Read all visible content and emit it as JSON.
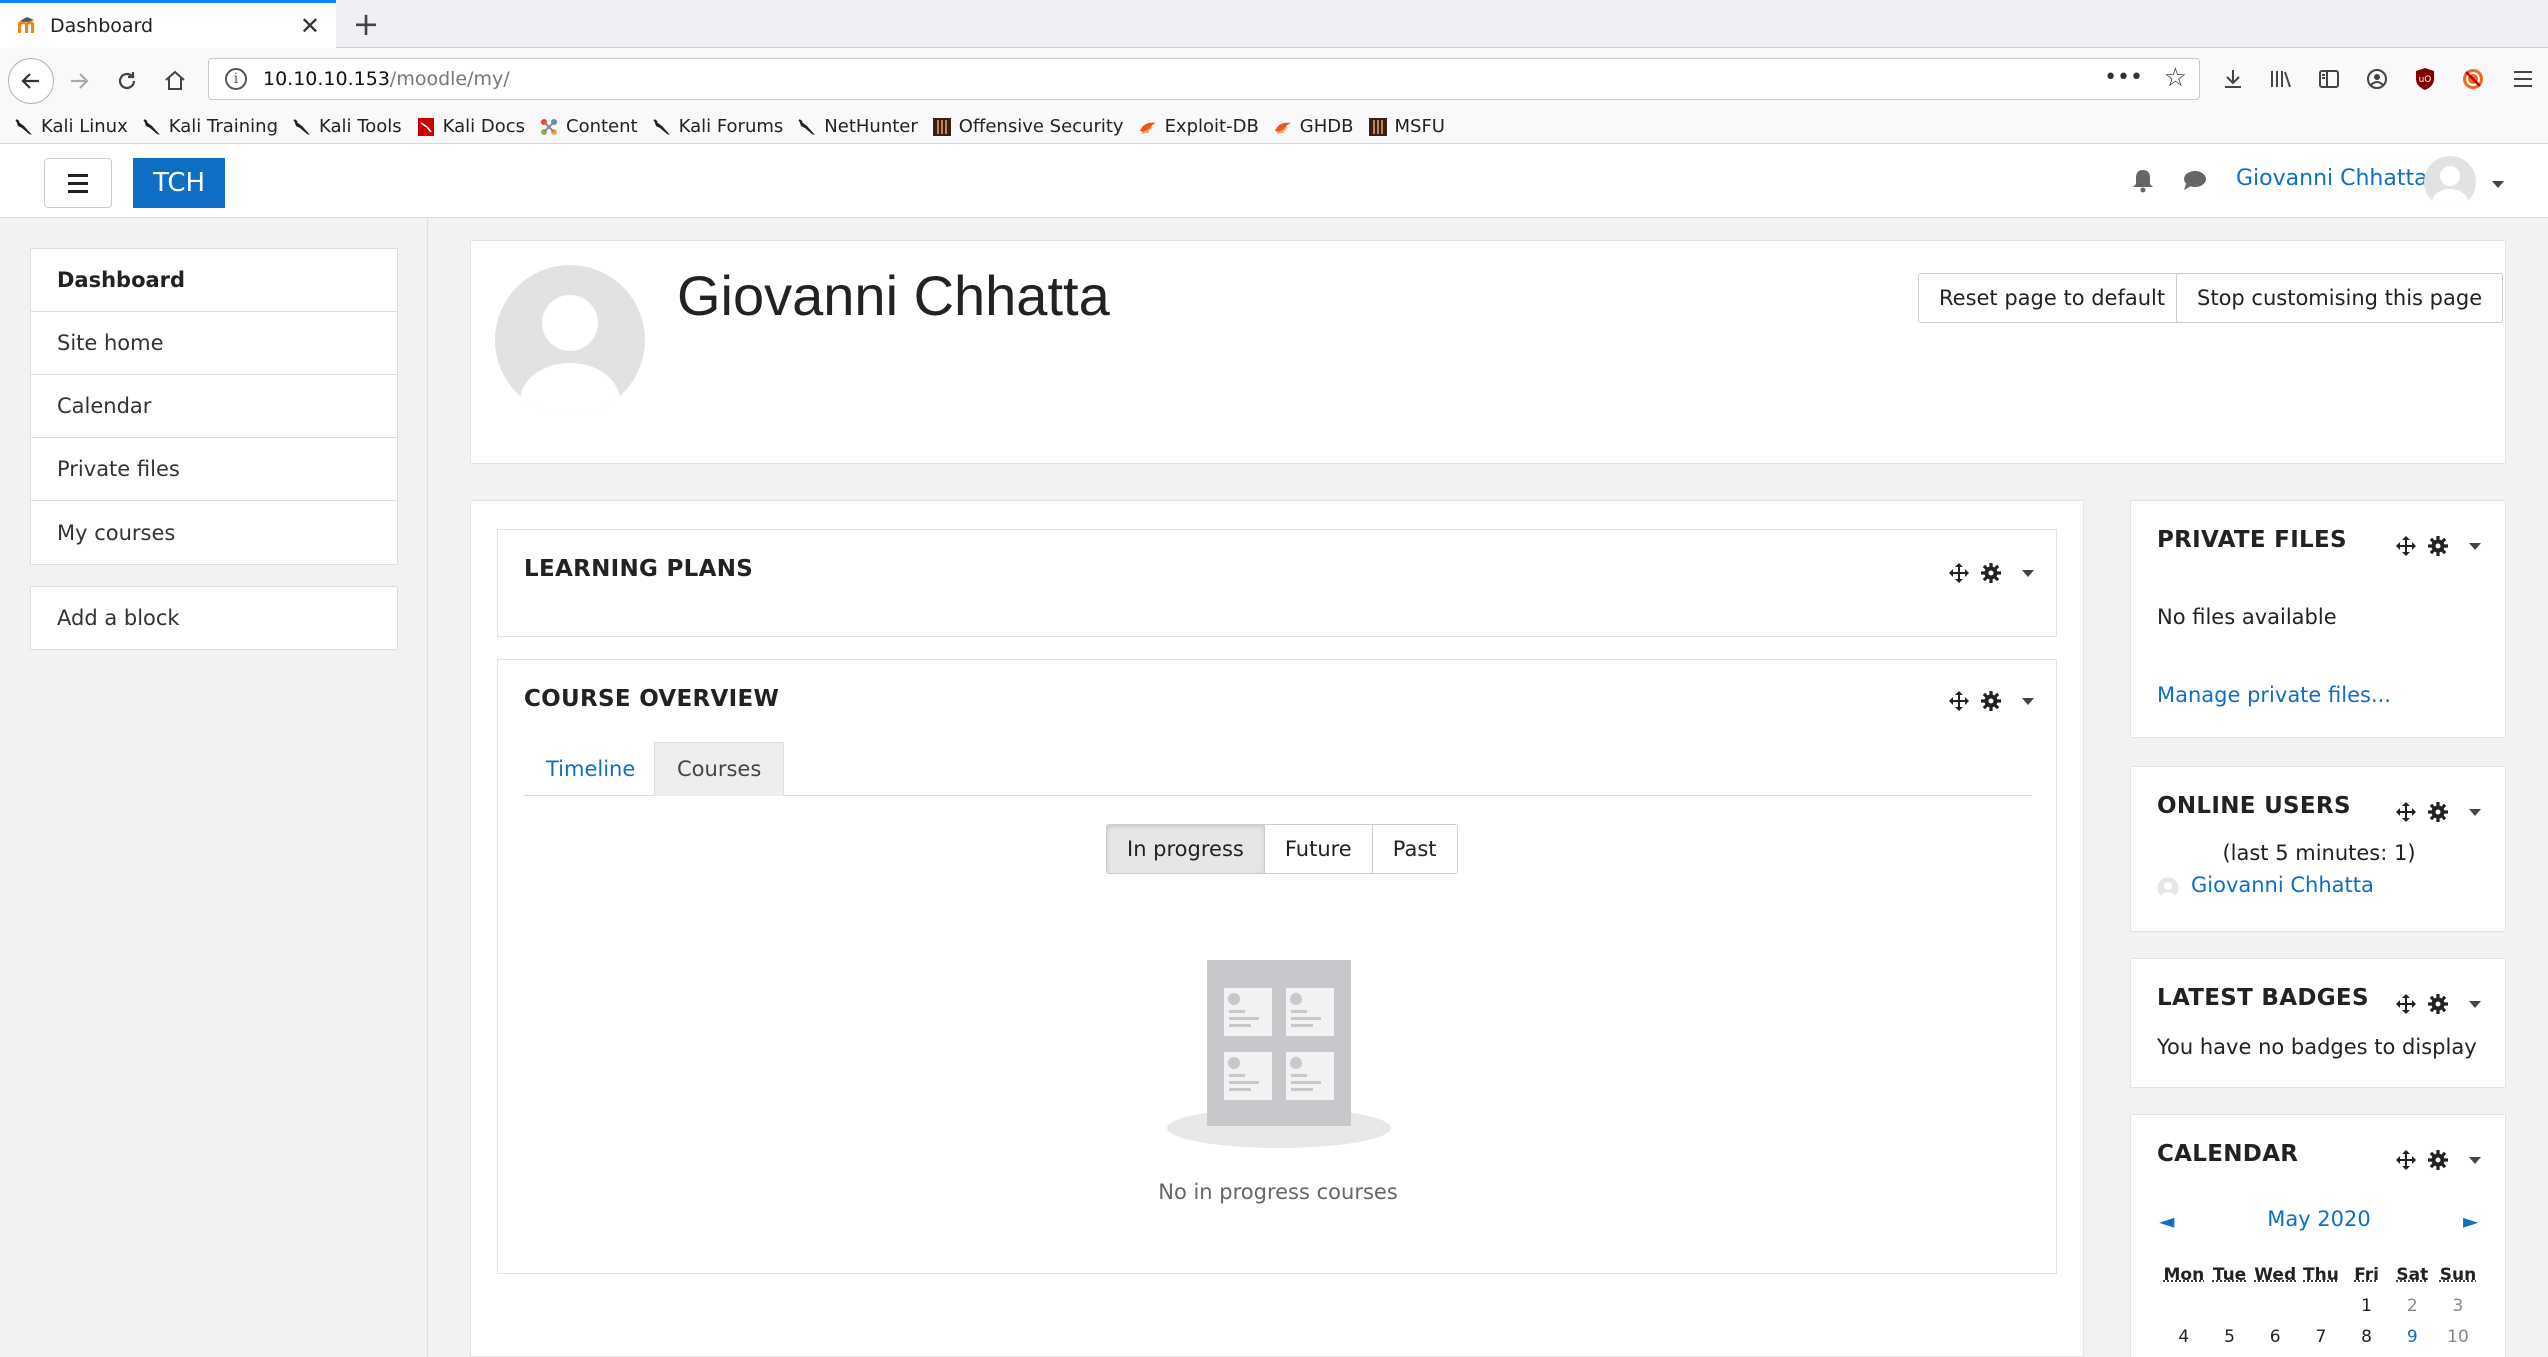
{
  "browser": {
    "tab_title": "Dashboard",
    "url_host": "10.10.10.153",
    "url_path": "/moodle/my/",
    "bookmarks": [
      {
        "label": "Kali Linux",
        "icon": "kali-dragon-icon"
      },
      {
        "label": "Kali Training",
        "icon": "kali-dragon-icon"
      },
      {
        "label": "Kali Tools",
        "icon": "kali-dragon-icon"
      },
      {
        "label": "Kali Docs",
        "icon": "kali-docs-icon"
      },
      {
        "label": "Content",
        "icon": "joomla-icon"
      },
      {
        "label": "Kali Forums",
        "icon": "kali-dragon-icon"
      },
      {
        "label": "NetHunter",
        "icon": "kali-dragon-icon"
      },
      {
        "label": "Offensive Security",
        "icon": "offsec-icon"
      },
      {
        "label": "Exploit-DB",
        "icon": "exploitdb-icon"
      },
      {
        "label": "GHDB",
        "icon": "exploitdb-icon"
      },
      {
        "label": "MSFU",
        "icon": "offsec-icon"
      }
    ]
  },
  "header": {
    "site_name": "TCH",
    "user_name": "Giovanni Chhatta"
  },
  "nav": {
    "items": [
      {
        "label": "Dashboard",
        "active": true
      },
      {
        "label": "Site home"
      },
      {
        "label": "Calendar"
      },
      {
        "label": "Private files"
      },
      {
        "label": "My courses"
      }
    ],
    "add_block": "Add a block"
  },
  "page": {
    "title": "Giovanni Chhatta",
    "reset_button": "Reset page to default",
    "stop_button": "Stop customising this page"
  },
  "learning_plans": {
    "title": "LEARNING PLANS"
  },
  "course_overview": {
    "title": "COURSE OVERVIEW",
    "tabs": [
      "Timeline",
      "Courses"
    ],
    "filters": [
      "In progress",
      "Future",
      "Past"
    ],
    "empty_text": "No in progress courses"
  },
  "private_files": {
    "title": "PRIVATE FILES",
    "empty": "No files available",
    "manage_link": "Manage private files..."
  },
  "online_users": {
    "title": "ONLINE USERS",
    "summary": "(last 5 minutes: 1)",
    "user": "Giovanni Chhatta"
  },
  "latest_badges": {
    "title": "LATEST BADGES",
    "empty": "You have no badges to display"
  },
  "calendar": {
    "title": "CALENDAR",
    "month": "May 2020",
    "prev": "◄",
    "next": "►",
    "days": [
      "Mon",
      "Tue",
      "Wed",
      "Thu",
      "Fri",
      "Sat",
      "Sun"
    ],
    "row1": [
      "",
      "",
      "",
      "",
      "1",
      "2",
      "3"
    ],
    "row2": [
      "4",
      "5",
      "6",
      "7",
      "8",
      "9",
      "10"
    ]
  }
}
